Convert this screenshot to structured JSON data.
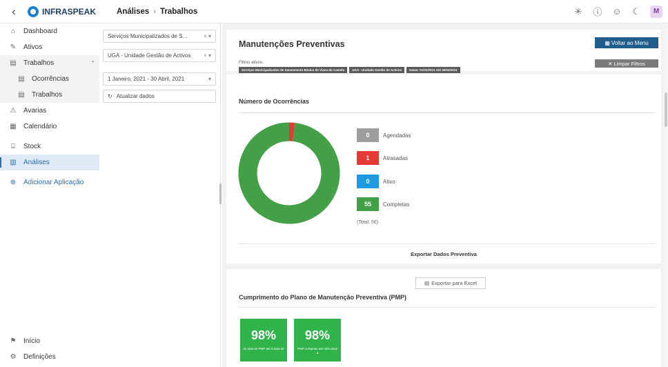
{
  "topbar": {
    "back_glyph": "‹",
    "app_name": "INFRASPEAK",
    "breadcrumb": [
      "Análises",
      "Trabalhos"
    ],
    "icons": [
      "asterisk-icon",
      "info-icon",
      "smile-icon",
      "moon-icon"
    ],
    "avatar_initial": "M"
  },
  "sidebar": {
    "items": [
      {
        "label": "Dashboard",
        "icon": "home-icon"
      },
      {
        "label": "Ativos",
        "icon": "wrench-icon"
      },
      {
        "label": "Trabalhos",
        "icon": "clipboard-icon"
      },
      {
        "label": "Ocorrências",
        "icon": "clipboard-icon"
      },
      {
        "label": "Trabalhos",
        "icon": "clipboard-icon"
      },
      {
        "label": "Avarias",
        "icon": "warning-icon"
      },
      {
        "label": "Calendário",
        "icon": "calendar-icon"
      },
      {
        "label": "Stock",
        "icon": "box-icon"
      },
      {
        "label": "Análises",
        "icon": "chart-icon"
      },
      {
        "label": "Adicionar Aplicação",
        "icon": "plus-circle-icon"
      }
    ],
    "bottom": [
      {
        "label": "Início",
        "icon": "flag-icon"
      },
      {
        "label": "Definições",
        "icon": "gear-icon"
      }
    ]
  },
  "filters": {
    "client": "Serviços Municipalizados de S...",
    "unit": "UGA - Unidade Gestão de Activos",
    "date_range": "1 Janeiro, 2021 - 30 Abril, 2021",
    "refresh_label": "Atualizar dados"
  },
  "report": {
    "title": "Manutenções Preventivas",
    "back_button": "Voltar ao Menu",
    "clear_button": "✕ Limpar Filtros",
    "active_filters_label": "Filtros ativos:",
    "active_filters": [
      "Serviços Municipalizados de Saneamento Básico de Viana do Castelo",
      "UGA - Unidade Gestão de Activos",
      "Datas: 01/01/2021 Até 30/04/2021"
    ]
  },
  "occurrences": {
    "title": "Número de Ocorrências",
    "total_label": "(Total: 56)",
    "export_title": "Exportar Dados Preventiva"
  },
  "chart_data": {
    "type": "pie",
    "categories": [
      "Agendadas",
      "Atrasadas",
      "Ativo",
      "Completas"
    ],
    "values": [
      0,
      1,
      0,
      55
    ],
    "colors": [
      "#9e9e9e",
      "#e53935",
      "#1e9be0",
      "#43a047"
    ],
    "donut": true
  },
  "pmp": {
    "excel_button": "Exportar para Excel",
    "title": "Cumprimento do Plano de Manutenção Preventiva (PMP)",
    "kpis": [
      {
        "value": "98%",
        "caption": "do total do PMP até à data de"
      },
      {
        "value": "98%",
        "caption": "PMP cumprido até mês atual a"
      }
    ],
    "kpi_color": "#2fb34a"
  }
}
